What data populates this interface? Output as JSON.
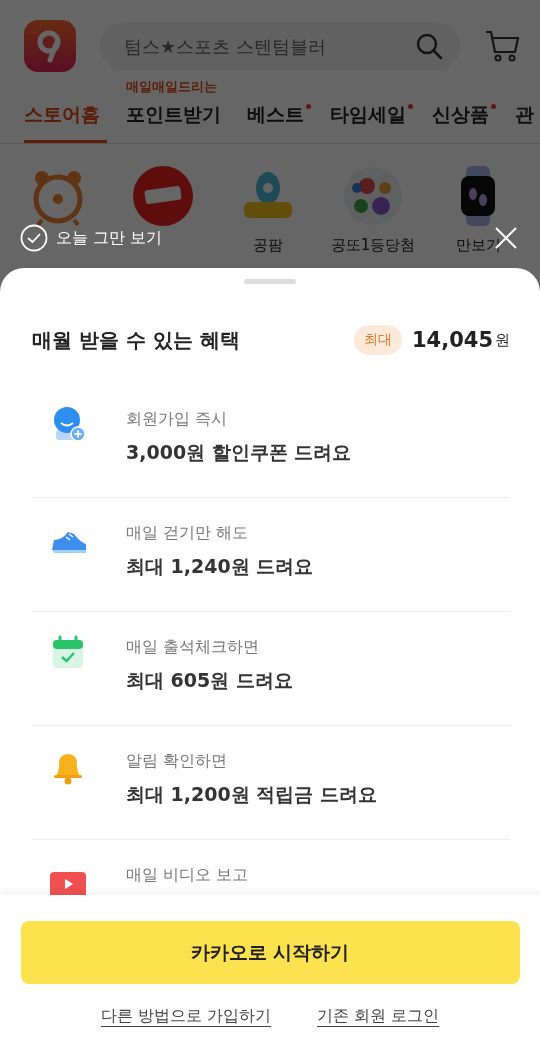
{
  "header": {
    "search": {
      "placeholder": "텀스★스포츠 스텐텀블러"
    }
  },
  "tabs": [
    {
      "label": "스토어홈",
      "selected": true,
      "dot": false
    },
    {
      "label": "포인트받기",
      "selected": false,
      "dot": false,
      "badge": "매일매일드리는"
    },
    {
      "label": "베스트",
      "selected": false,
      "dot": true
    },
    {
      "label": "타임세일",
      "selected": false,
      "dot": true
    },
    {
      "label": "신상품",
      "selected": false,
      "dot": true
    },
    {
      "label": "관",
      "selected": false,
      "dot": false
    }
  ],
  "categories": [
    {
      "kind": "clock"
    },
    {
      "kind": "hotdeal"
    },
    {
      "kind": "farm",
      "label": "공팜"
    },
    {
      "kind": "lotto",
      "label": "공또1등당첨"
    },
    {
      "kind": "watch",
      "label": "만보기"
    }
  ],
  "dismiss": {
    "label": "오늘 그만 보기",
    "checked": false
  },
  "sheet": {
    "title": "매월 받을 수 있는 혜택",
    "max_badge": "최대",
    "max_amount": "14,045",
    "max_unit": "원",
    "benefits": [
      {
        "kind": "member",
        "subtitle": "회원가입 즉시",
        "text": "3,000원 할인쿠폰 드려요"
      },
      {
        "kind": "shoe",
        "subtitle": "매일 걷기만 해도",
        "text": "최대 1,240원 드려요"
      },
      {
        "kind": "calendar",
        "subtitle": "매일 출석체크하면",
        "text": "최대 605원 드려요"
      },
      {
        "kind": "bell",
        "subtitle": "알림 확인하면",
        "text": "최대 1,200원 적립금 드려요"
      },
      {
        "kind": "video",
        "subtitle": "매일 비디오 보고"
      }
    ],
    "primary_button": "카카오로 시작하기",
    "links": [
      "다른 방법으로 가입하기",
      "기존 회원 로그인"
    ]
  }
}
